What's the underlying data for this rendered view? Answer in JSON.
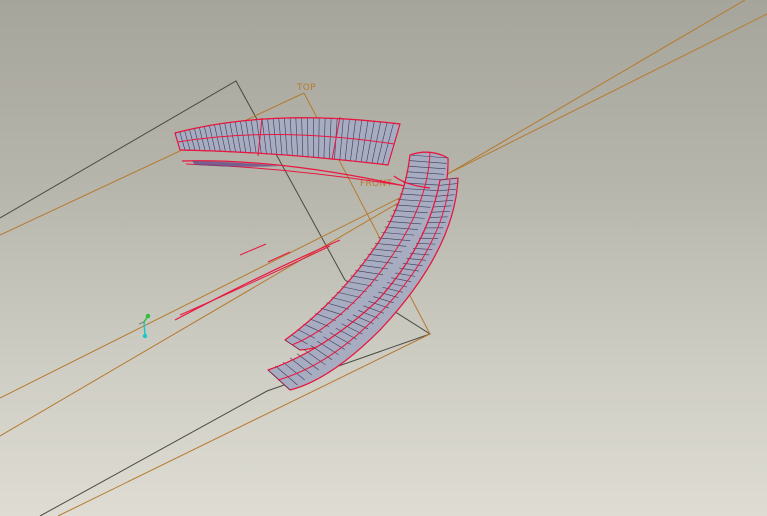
{
  "viewport": {
    "datum_planes": [
      {
        "id": "top",
        "label": "TOP"
      },
      {
        "id": "front",
        "label": "FRONT"
      }
    ],
    "colors": {
      "datum_plane": "#b57a2e",
      "datum_plane_dark": "#4a4a44",
      "surface_edge": "#e8173f",
      "surface_mesh": "#3c3c5a",
      "surface_fill": "#a7acc0",
      "csys_x": "#2fbf3a",
      "csys_y": "#18c7c9"
    },
    "icons": {
      "coordinate_system": "csys-triad-icon"
    }
  }
}
